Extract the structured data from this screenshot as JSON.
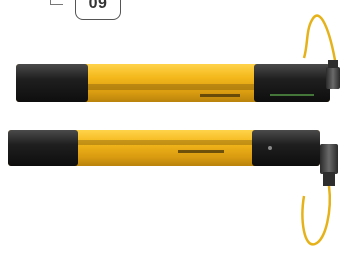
{
  "badge": {
    "text": "09"
  },
  "colors": {
    "housing_yellow": "#f4b81c",
    "housing_dark": "#1b1b1b",
    "cable_yellow": "#e6b21a",
    "connector_gray": "#3a3a3a",
    "background": "#ffffff"
  },
  "icons": [
    "light-curtain-emitter-image",
    "light-curtain-receiver-image",
    "m12-connector-icon",
    "cable-icon"
  ]
}
